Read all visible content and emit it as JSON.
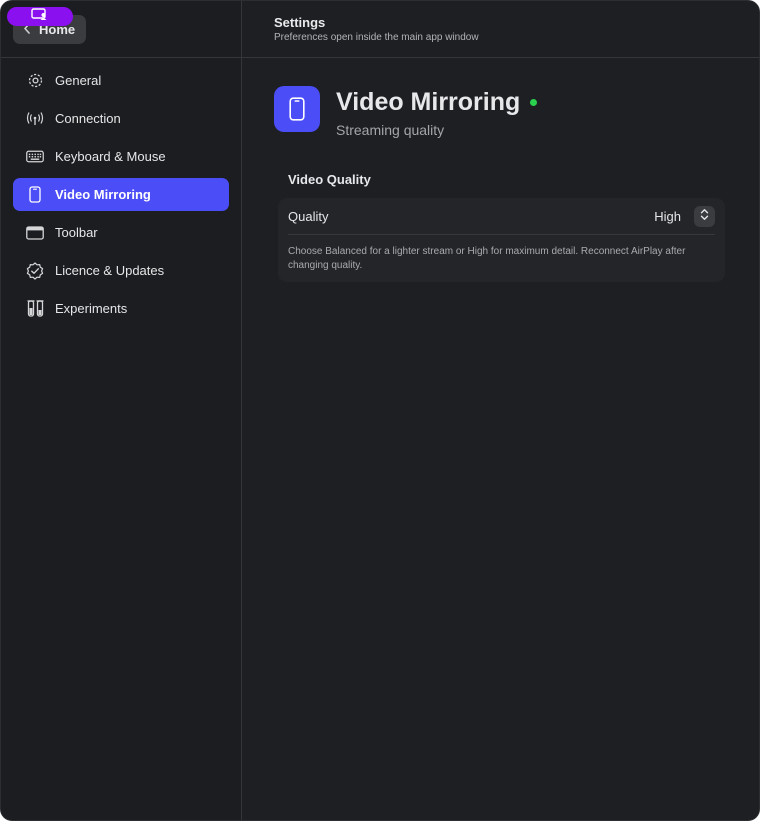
{
  "sidebar": {
    "home_label": "Home",
    "items": [
      {
        "label": "General",
        "icon": "gear-icon",
        "active": false
      },
      {
        "label": "Connection",
        "icon": "antenna-icon",
        "active": false
      },
      {
        "label": "Keyboard & Mouse",
        "icon": "keyboard-icon",
        "active": false
      },
      {
        "label": "Video Mirroring",
        "icon": "phone-icon",
        "active": true
      },
      {
        "label": "Toolbar",
        "icon": "toolbar-icon",
        "active": false
      },
      {
        "label": "Licence & Updates",
        "icon": "checkmark-seal-icon",
        "active": false
      },
      {
        "label": "Experiments",
        "icon": "test-tubes-icon",
        "active": false
      }
    ]
  },
  "header": {
    "title": "Settings",
    "subtitle": "Preferences open inside the main app window"
  },
  "hero": {
    "title": "Video Mirroring",
    "subtitle": "Streaming quality",
    "status_color": "#29d14e"
  },
  "section": {
    "title": "Video Quality",
    "quality_label": "Quality",
    "quality_value": "High",
    "help_text": "Choose Balanced for a lighter stream or High for maximum detail. Reconnect AirPlay after changing quality."
  },
  "colors": {
    "accent": "#4b4df7",
    "badge": "#8b10f0",
    "background": "#1d1f22"
  }
}
